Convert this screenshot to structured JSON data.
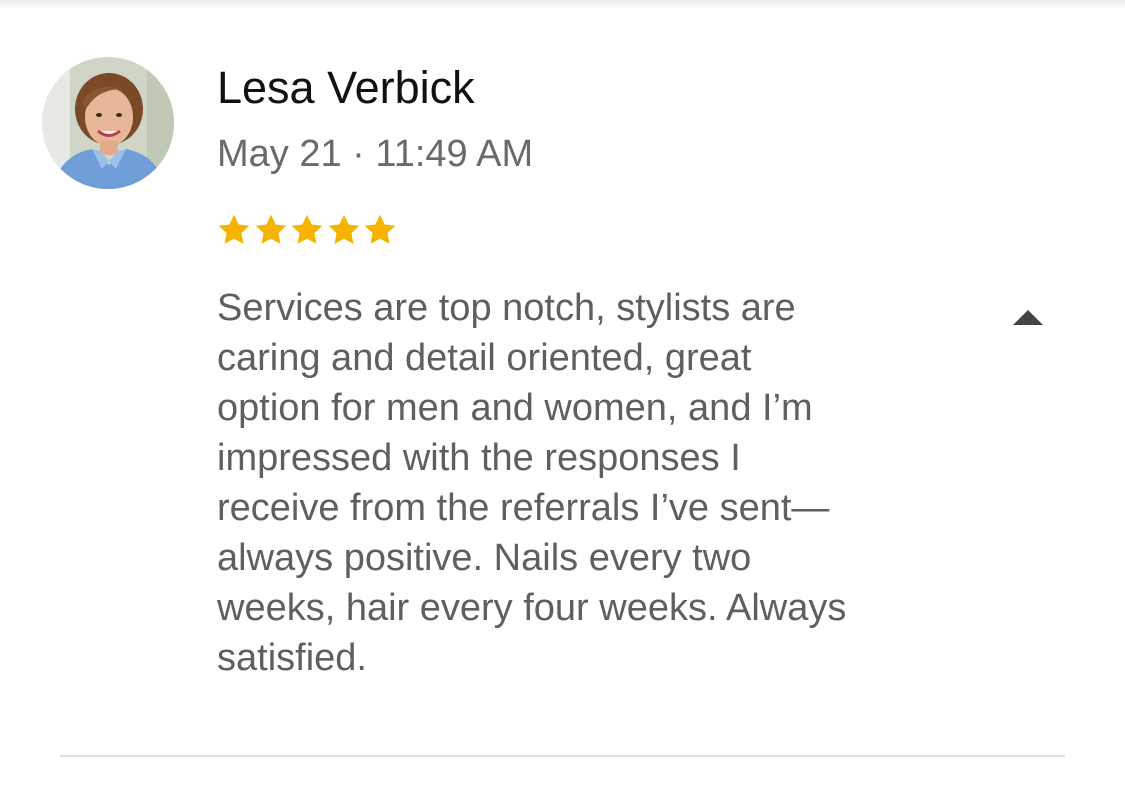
{
  "review": {
    "reviewer_name": "Lesa Verbick",
    "date_time": "May 21 · 11:49 AM",
    "rating": 5,
    "rating_max": 5,
    "star_color": "#F4B400",
    "text": "Services are top notch, stylists are\ncaring and detail oriented, great\noption for men and women, and I’m\nimpressed with the responses I\nreceive from the referrals I’ve sent—\nalways positive. Nails every two\nweeks, hair every four weeks. Always\nsatisfied.",
    "collapse_icon": "caret-up-icon"
  },
  "colors": {
    "name": "#111111",
    "meta": "#6a6a6a",
    "body_text": "#5f5f5f",
    "divider": "#dedede",
    "caret": "#444444"
  }
}
